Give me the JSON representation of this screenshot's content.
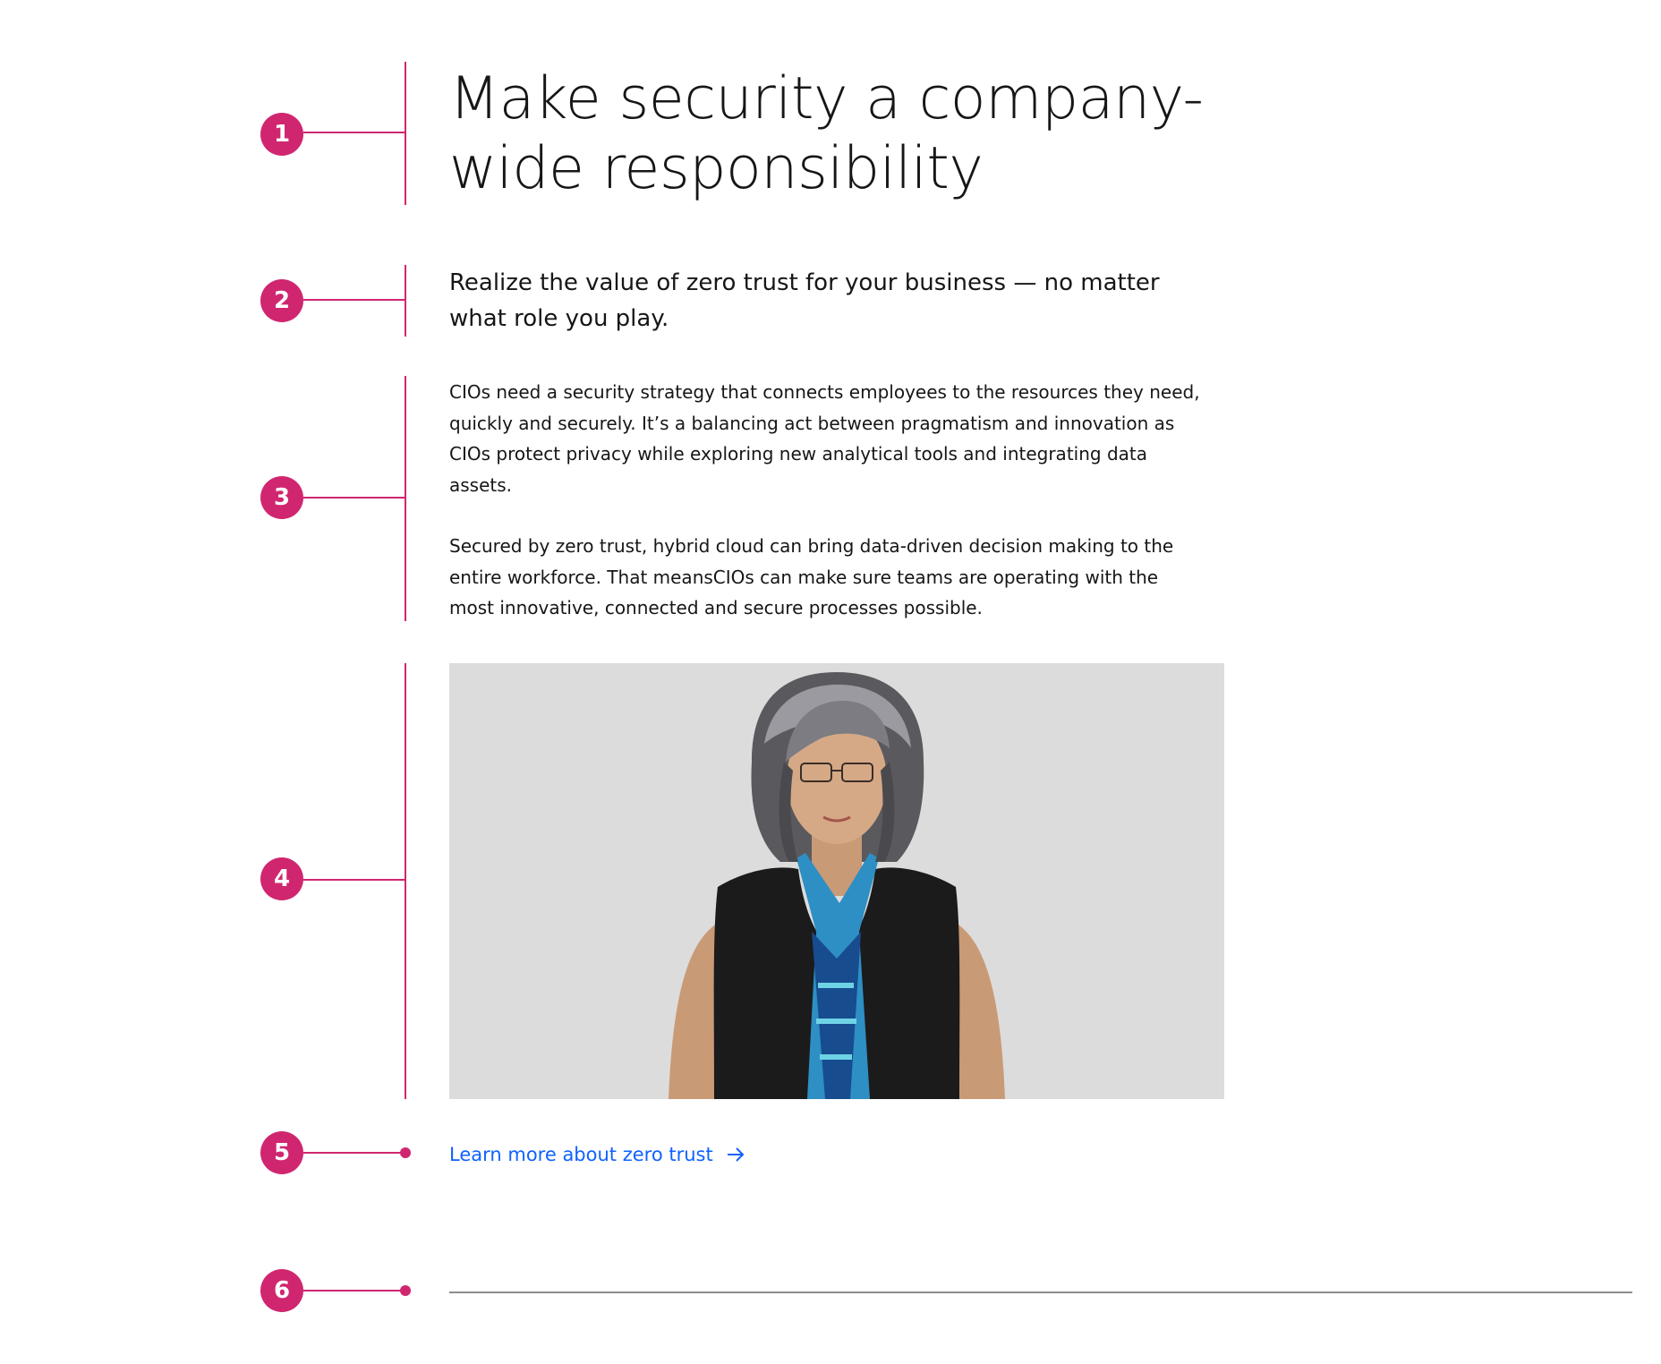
{
  "annotations": {
    "markers": [
      "1",
      "2",
      "3",
      "4",
      "5",
      "6"
    ],
    "color": "#d02670"
  },
  "content": {
    "heading": "Make security a company-wide responsibility",
    "subheading": "Realize the value of zero trust for your business — no matter what role you play.",
    "paragraph_1": "CIOs need a security strategy that connects employees to the resources they need, quickly and securely. It’s a balancing act between pragmatism and innovation as CIOs protect privacy while exploring new analytical tools and integrating data assets.",
    "paragraph_2": "Secured by zero trust, hybrid cloud can bring data-driven decision making to the entire workforce. That meansCIOs can make sure teams are operating with the most innovative, connected and secure processes possible.",
    "image": {
      "background": "#dcdcdc",
      "icon": "portrait-photo"
    },
    "link": {
      "label": "Learn more about zero trust",
      "icon": "arrow-right-icon",
      "color": "#0f62fe"
    },
    "divider_color": "#8d8d8d"
  }
}
